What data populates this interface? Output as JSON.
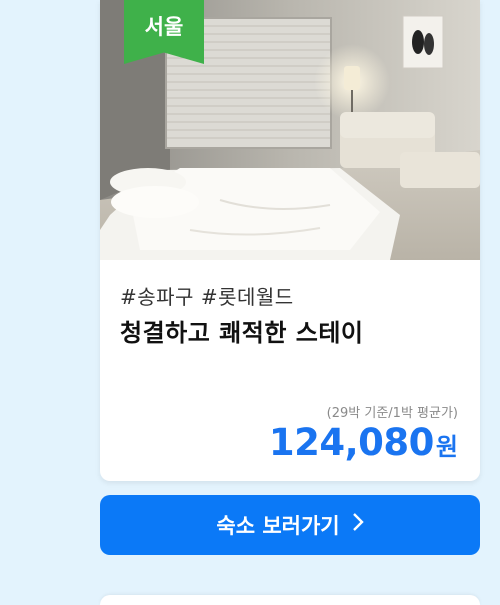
{
  "listing": {
    "region_badge": "서울",
    "tags": "#송파구 #롯데월드",
    "title": "청결하고 쾌적한 스테이",
    "price_note": "(29박 기준/1박 평균가)",
    "price": "124,080",
    "price_unit": "원"
  },
  "cta": {
    "label": "숙소 보러가기",
    "icon": "chevron-right-icon"
  },
  "colors": {
    "badge": "#3fb14a",
    "price": "#1a74f0",
    "cta": "#0b79f7",
    "background": "#e3f3fd"
  }
}
